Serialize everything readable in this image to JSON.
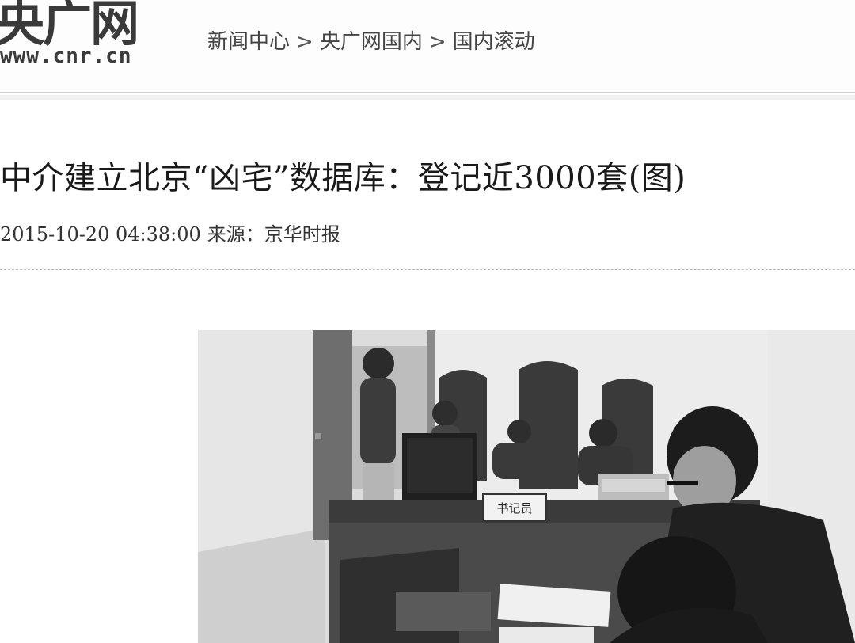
{
  "header": {
    "logo_text": "央广网",
    "logo_url": "www.cnr.cn",
    "breadcrumb": [
      "新闻中心",
      "央广网国内",
      "国内滚动"
    ],
    "breadcrumb_sep": ">"
  },
  "article": {
    "title": "中介建立北京“凶宅”数据库：登记近3000套(图)",
    "datetime": "2015-10-20 04:38:00",
    "source_label": "来源：",
    "source": "京华时报"
  },
  "photo": {
    "sign_text": "书记员"
  }
}
